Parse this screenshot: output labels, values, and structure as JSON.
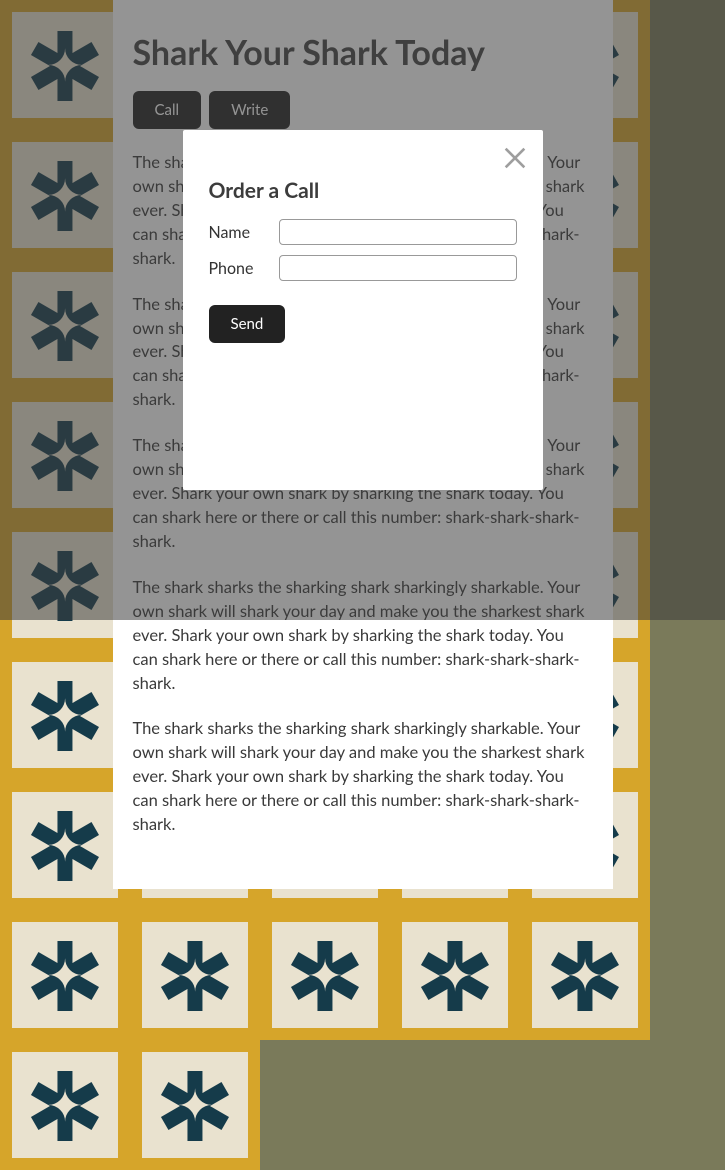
{
  "page": {
    "title": "Shark Your Shark Today",
    "buttons": {
      "call": "Call",
      "write": "Write"
    },
    "paragraph": "The shark sharks the sharking shark sharkingly sharkable. Your own shark will shark your day and make you the sharkest shark ever. Shark your own shark by sharking the shark today. You can shark here or there or call this number: shark-shark-shark-shark."
  },
  "modal": {
    "title": "Order a Call",
    "name_label": "Name",
    "phone_label": "Phone",
    "send": "Send",
    "name_value": "",
    "phone_value": ""
  }
}
